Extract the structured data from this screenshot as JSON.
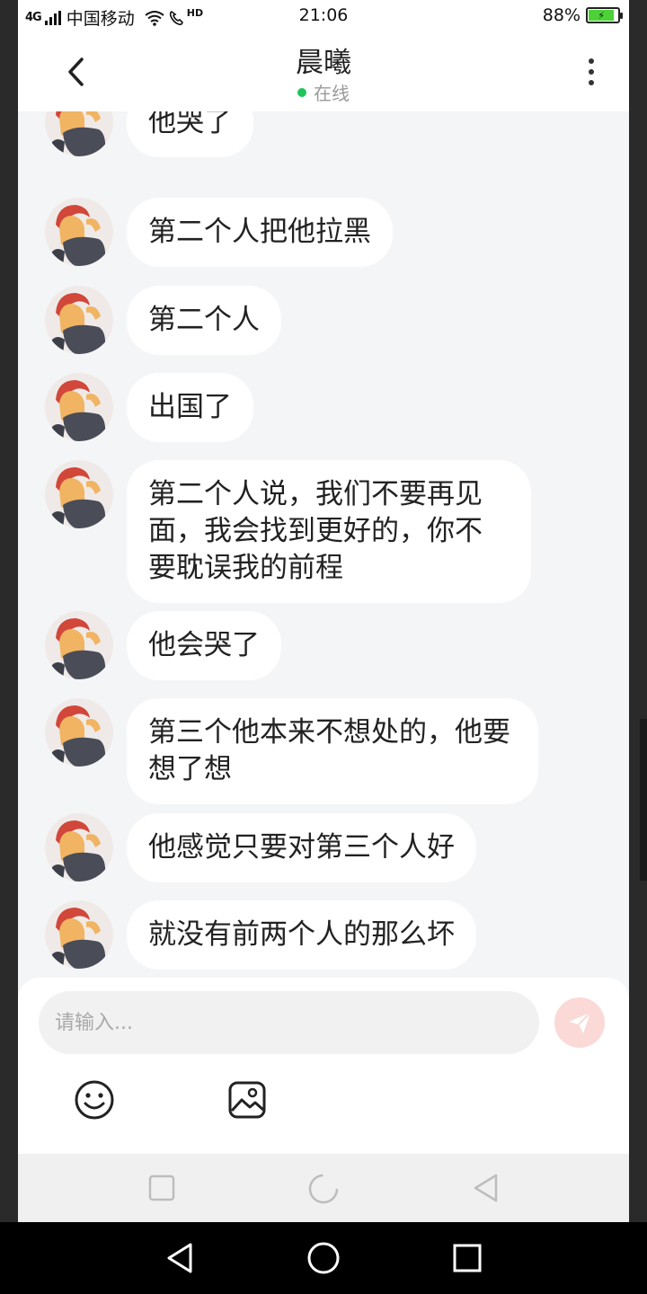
{
  "status_bar": {
    "signal": "4G",
    "hd": "HD",
    "carrier": "中国移动",
    "time": "21:06",
    "battery": "88%"
  },
  "header": {
    "title": "晨曦",
    "status": "在线",
    "status_color": "#21c35d"
  },
  "messages": [
    {
      "text": "他哭了"
    },
    {
      "text": "第二个人把他拉黑"
    },
    {
      "text": "第二个人"
    },
    {
      "text": "出国了"
    },
    {
      "text": "第二个人说，我们不要再见面，我会找到更好的，你不要耽误我的前程"
    },
    {
      "text": "他会哭了"
    },
    {
      "text": "第三个他本来不想处的，他要想了想"
    },
    {
      "text": "他感觉只要对第三个人好"
    },
    {
      "text": "就没有前两个人的那么坏"
    }
  ],
  "input": {
    "placeholder": "请输入..."
  },
  "icons": {
    "back": "chevron-left-icon",
    "more": "more-vertical-icon",
    "send": "paper-plane-icon",
    "emoji": "smiley-icon",
    "image": "image-icon",
    "send_color": "#fbd9d6"
  }
}
